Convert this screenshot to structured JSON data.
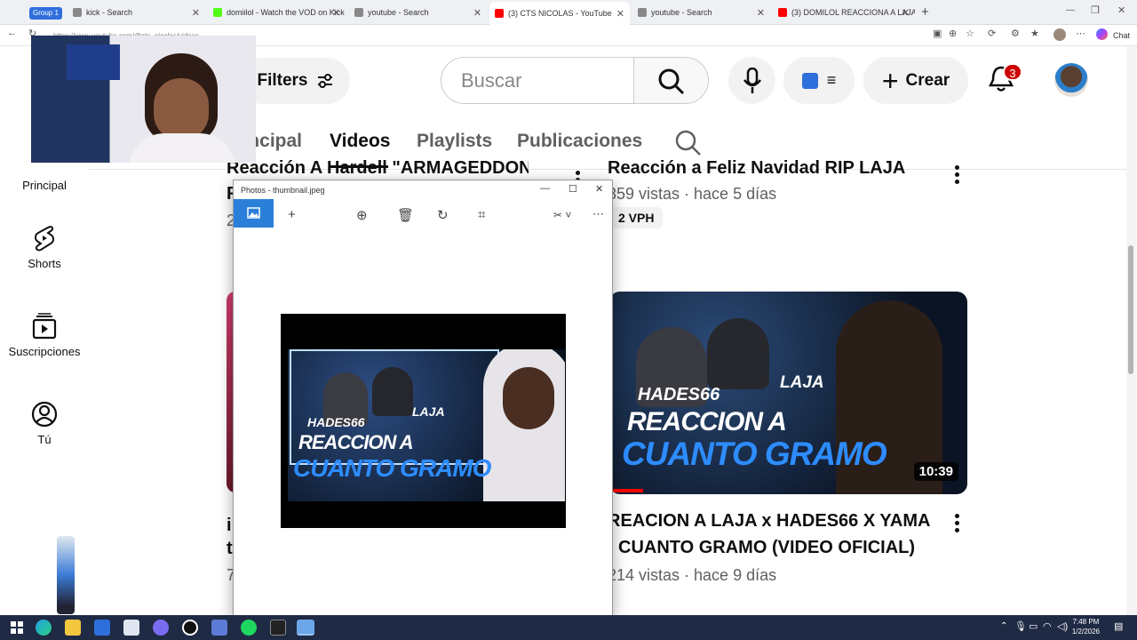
{
  "browser": {
    "group_label": "Group 1",
    "tabs": [
      {
        "title": "kick - Search"
      },
      {
        "title": "domiilol - Watch the VOD on Kick"
      },
      {
        "title": "youtube - Search"
      },
      {
        "title": "(3) CTS NICOLAS - YouTube"
      },
      {
        "title": "youtube - Search"
      },
      {
        "title": "(3) DOMILOL REACCIONA A LAJA"
      }
    ],
    "url": "https://www.youtube.com/@cts_nicolas/videos",
    "chat_label": "Chat"
  },
  "youtube": {
    "filters_label": "Filters",
    "search_placeholder": "Buscar",
    "create_label": "Crear",
    "notification_count": "3",
    "tabs": [
      "Principal",
      "Videos",
      "Playlists",
      "Publicaciones"
    ],
    "active_tab": "Videos",
    "sidebar": [
      {
        "label": "Principal",
        "icon": "home-icon"
      },
      {
        "label": "Shorts",
        "icon": "shorts-icon"
      },
      {
        "label": "Suscripciones",
        "icon": "subscriptions-icon"
      },
      {
        "label": "Tú",
        "icon": "profile-icon"
      }
    ],
    "videos": [
      {
        "title_line1": "Reacción A Hardell \"ARMAGEDDON\"",
        "title_line2": "F",
        "meta": "2"
      },
      {
        "title_line1": "Reacción a Feliz Navidad RIP LAJA",
        "meta": "359 vistas · hace 5 días",
        "badge": "2 VPH"
      },
      {
        "title_line1": "i",
        "title_line2": "t",
        "meta": "7"
      },
      {
        "title_line1": "REACION A LAJA x HADES66 X YAMA",
        "title_line2": "CUANTO GRAMO (VIDEO OFICIAL)",
        "meta": "214 vistas · hace 9 días",
        "duration": "10:39",
        "thumb_text1": "HADES66",
        "thumb_text2": "LAJA",
        "thumb_text3": "REACCION A",
        "thumb_text4": "CUANTO GRAMO"
      }
    ]
  },
  "photos_window": {
    "title": "Photos - thumbnail.jpeg",
    "thumb_text1": "HADES66",
    "thumb_text2": "LAJA",
    "thumb_text3": "REACCION A",
    "thumb_text4": "CUANTO GRAMO"
  },
  "taskbar": {
    "time": "7:48 PM",
    "date": "1/2/2026"
  }
}
